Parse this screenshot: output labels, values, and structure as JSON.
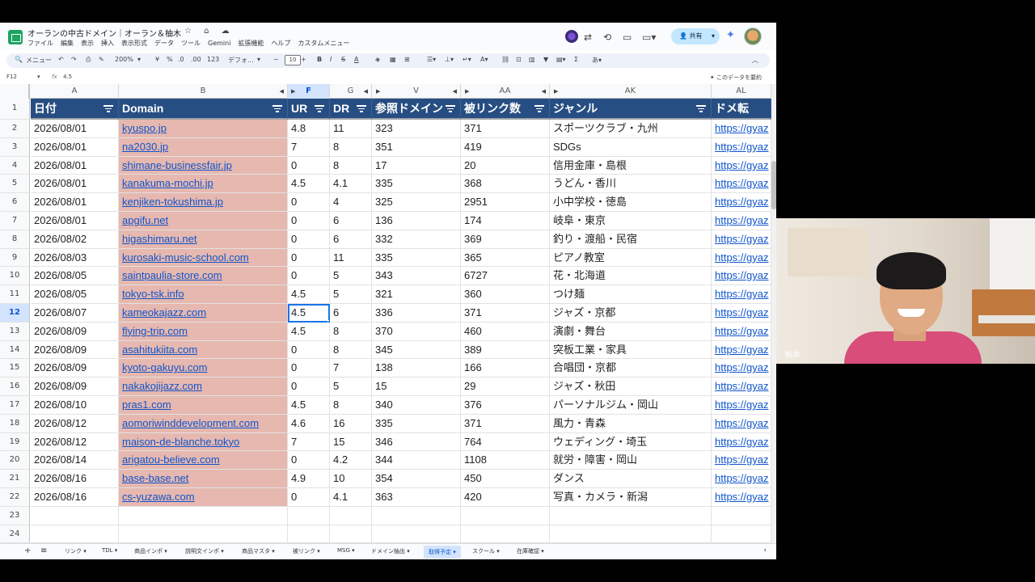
{
  "doc": {
    "title": "オーランの中古ドメイン｜オーラン＆柚木",
    "icons": "☆ ⌂ ☁",
    "menu": [
      "ファイル",
      "編集",
      "表示",
      "挿入",
      "表示形式",
      "データ",
      "ツール",
      "Gemini",
      "拡張機能",
      "ヘルプ",
      "カスタムメニュー"
    ],
    "share_label": "共有"
  },
  "toolbar": {
    "menu_search": "メニュー",
    "zoom": "200%",
    "currency": "¥",
    "percent": "%",
    "decimals_minus": ".0",
    "decimals_plus": ".00",
    "number_format": "123",
    "font": "デフォ...",
    "font_size": "10"
  },
  "formula": {
    "cell_ref": "F12",
    "fx": "fx",
    "value": "4.5",
    "summarize": "このデータを要約"
  },
  "columns": [
    "A",
    "B",
    "F",
    "G",
    "V",
    "AA",
    "AK",
    "AL"
  ],
  "selected_column": "F",
  "selected_row": "12",
  "headers": {
    "row_number": "1",
    "date": "日付",
    "domain": "Domain",
    "ur": "UR",
    "dr": "DR",
    "ref_domains": "参照ドメイン",
    "backlinks": "被リンク数",
    "genre": "ジャンル",
    "transfer": "ドメ転"
  },
  "rows": [
    {
      "n": "2",
      "date": "2026/08/01",
      "domain": "kyuspo.jp",
      "ur": "4.8",
      "dr": "11",
      "ref": "323",
      "bl": "371",
      "genre": "スポーツクラブ・九州",
      "link": "https://gyaz"
    },
    {
      "n": "3",
      "date": "2026/08/01",
      "domain": "na2030.jp",
      "ur": "7",
      "dr": "8",
      "ref": "351",
      "bl": "419",
      "genre": "SDGs",
      "link": "https://gyaz"
    },
    {
      "n": "4",
      "date": "2026/08/01",
      "domain": "shimane-businessfair.jp",
      "ur": "0",
      "dr": "8",
      "ref": "17",
      "bl": "20",
      "genre": "信用金庫・島根",
      "link": "https://gyaz"
    },
    {
      "n": "5",
      "date": "2026/08/01",
      "domain": "kanakuma-mochi.jp",
      "ur": "4.5",
      "dr": "4.1",
      "ref": "335",
      "bl": "368",
      "genre": "うどん・香川",
      "link": "https://gyaz"
    },
    {
      "n": "6",
      "date": "2026/08/01",
      "domain": "kenjiken-tokushima.jp",
      "ur": "0",
      "dr": "4",
      "ref": "325",
      "bl": "2951",
      "genre": "小中学校・徳島",
      "link": "https://gyaz"
    },
    {
      "n": "7",
      "date": "2026/08/01",
      "domain": "apgifu.net",
      "ur": "0",
      "dr": "6",
      "ref": "136",
      "bl": "174",
      "genre": "岐阜・東京",
      "link": "https://gyaz"
    },
    {
      "n": "8",
      "date": "2026/08/02",
      "domain": "higashimaru.net",
      "ur": "0",
      "dr": "6",
      "ref": "332",
      "bl": "369",
      "genre": "釣り・渡船・民宿",
      "link": "https://gyaz"
    },
    {
      "n": "9",
      "date": "2026/08/03",
      "domain": "kurosaki-music-school.com",
      "ur": "0",
      "dr": "11",
      "ref": "335",
      "bl": "365",
      "genre": "ピアノ教室",
      "link": "https://gyaz"
    },
    {
      "n": "10",
      "date": "2026/08/05",
      "domain": "saintpaulia-store.com",
      "ur": "0",
      "dr": "5",
      "ref": "343",
      "bl": "6727",
      "genre": "花・北海道",
      "link": "https://gyaz"
    },
    {
      "n": "11",
      "date": "2026/08/05",
      "domain": "tokyo-tsk.info",
      "ur": "4.5",
      "dr": "5",
      "ref": "321",
      "bl": "360",
      "genre": "つけ麺",
      "link": "https://gyaz"
    },
    {
      "n": "12",
      "date": "2026/08/07",
      "domain": "kameokajazz.com",
      "ur": "4.5",
      "dr": "6",
      "ref": "336",
      "bl": "371",
      "genre": "ジャズ・京都",
      "link": "https://gyaz"
    },
    {
      "n": "13",
      "date": "2026/08/09",
      "domain": "flying-trip.com",
      "ur": "4.5",
      "dr": "8",
      "ref": "370",
      "bl": "460",
      "genre": "演劇・舞台",
      "link": "https://gyaz"
    },
    {
      "n": "14",
      "date": "2026/08/09",
      "domain": "asahitukiita.com",
      "ur": "0",
      "dr": "8",
      "ref": "345",
      "bl": "389",
      "genre": "突板工業・家具",
      "link": "https://gyaz"
    },
    {
      "n": "15",
      "date": "2026/08/09",
      "domain": "kyoto-gakuyu.com",
      "ur": "0",
      "dr": "7",
      "ref": "138",
      "bl": "166",
      "genre": "合唱団・京都",
      "link": "https://gyaz"
    },
    {
      "n": "16",
      "date": "2026/08/09",
      "domain": "nakakojijazz.com",
      "ur": "0",
      "dr": "5",
      "ref": "15",
      "bl": "29",
      "genre": "ジャズ・秋田",
      "link": "https://gyaz"
    },
    {
      "n": "17",
      "date": "2026/08/10",
      "domain": "pras1.com",
      "ur": "4.5",
      "dr": "8",
      "ref": "340",
      "bl": "376",
      "genre": "パーソナルジム・岡山",
      "link": "https://gyaz"
    },
    {
      "n": "18",
      "date": "2026/08/12",
      "domain": "aomoriwinddevelopment.com",
      "ur": "4.6",
      "dr": "16",
      "ref": "335",
      "bl": "371",
      "genre": "風力・青森",
      "link": "https://gyaz"
    },
    {
      "n": "19",
      "date": "2026/08/12",
      "domain": "maison-de-blanche.tokyo",
      "ur": "7",
      "dr": "15",
      "ref": "346",
      "bl": "764",
      "genre": "ウェディング・埼玉",
      "link": "https://gyaz"
    },
    {
      "n": "20",
      "date": "2026/08/14",
      "domain": "arigatou-believe.com",
      "ur": "0",
      "dr": "4.2",
      "ref": "344",
      "bl": "1108",
      "genre": "就労・障害・岡山",
      "link": "https://gyaz"
    },
    {
      "n": "21",
      "date": "2026/08/16",
      "domain": "base-base.net",
      "ur": "4.9",
      "dr": "10",
      "ref": "354",
      "bl": "450",
      "genre": "ダンス",
      "link": "https://gyaz"
    },
    {
      "n": "22",
      "date": "2026/08/16",
      "domain": "cs-yuzawa.com",
      "ur": "0",
      "dr": "4.1",
      "ref": "363",
      "bl": "420",
      "genre": "写真・カメラ・新潟",
      "link": "https://gyaz"
    }
  ],
  "empty_rows": [
    "23",
    "24"
  ],
  "tabs": [
    {
      "label": "リンク ▾",
      "active": false
    },
    {
      "label": "TDL ▾",
      "active": false
    },
    {
      "label": "商品インポ ▾",
      "active": false
    },
    {
      "label": "説明文インポ ▾",
      "active": false
    },
    {
      "label": "商品マスタ ▾",
      "active": false
    },
    {
      "label": "被リンク ▾",
      "active": false
    },
    {
      "label": "MSG ▾",
      "active": false
    },
    {
      "label": "ドメイン抽出 ▾",
      "active": false
    },
    {
      "label": "取得予定 ▾",
      "active": true
    },
    {
      "label": "スクール ▾",
      "active": false
    },
    {
      "label": "在庫確認 ▾",
      "active": false
    }
  ],
  "video": {
    "participant_name": "柚木"
  },
  "colors": {
    "header_bg": "#274e82",
    "domain_bg": "#e6b8af",
    "link": "#1155cc",
    "selection": "#1a73e8"
  }
}
